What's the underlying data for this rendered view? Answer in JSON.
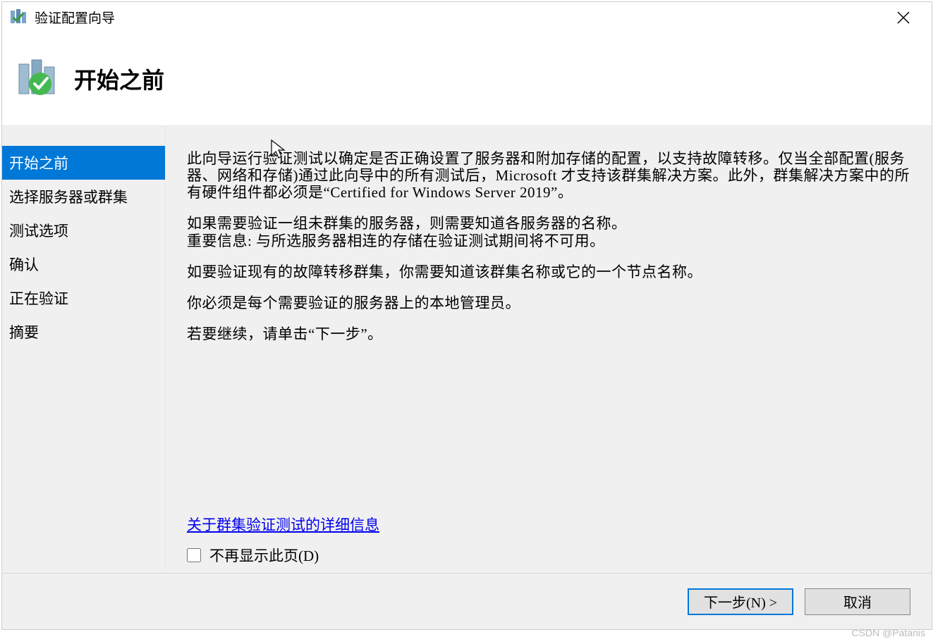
{
  "window": {
    "title": "验证配置向导"
  },
  "header": {
    "title": "开始之前"
  },
  "sidebar": {
    "items": [
      {
        "label": "开始之前",
        "active": true
      },
      {
        "label": "选择服务器或群集",
        "active": false
      },
      {
        "label": "测试选项",
        "active": false
      },
      {
        "label": "确认",
        "active": false
      },
      {
        "label": "正在验证",
        "active": false
      },
      {
        "label": "摘要",
        "active": false
      }
    ]
  },
  "content": {
    "paragraphs": [
      "此向导运行验证测试以确定是否正确设置了服务器和附加存储的配置，以支持故障转移。仅当全部配置(服务器、网络和存储)通过此向导中的所有测试后，Microsoft 才支持该群集解决方案。此外，群集解决方案中的所有硬件组件都必须是“Certified for Windows Server 2019”。",
      "如果需要验证一组未群集的服务器，则需要知道各服务器的名称。\n重要信息: 与所选服务器相连的存储在验证测试期间将不可用。",
      "如要验证现有的故障转移群集，你需要知道该群集名称或它的一个节点名称。",
      "你必须是每个需要验证的服务器上的本地管理员。",
      "若要继续，请单击“下一步”。"
    ],
    "link": "关于群集验证测试的详细信息",
    "checkbox_label": "不再显示此页(D)"
  },
  "footer": {
    "next_label": "下一步(N) >",
    "cancel_label": "取消"
  },
  "watermark": "CSDN @Patanis"
}
